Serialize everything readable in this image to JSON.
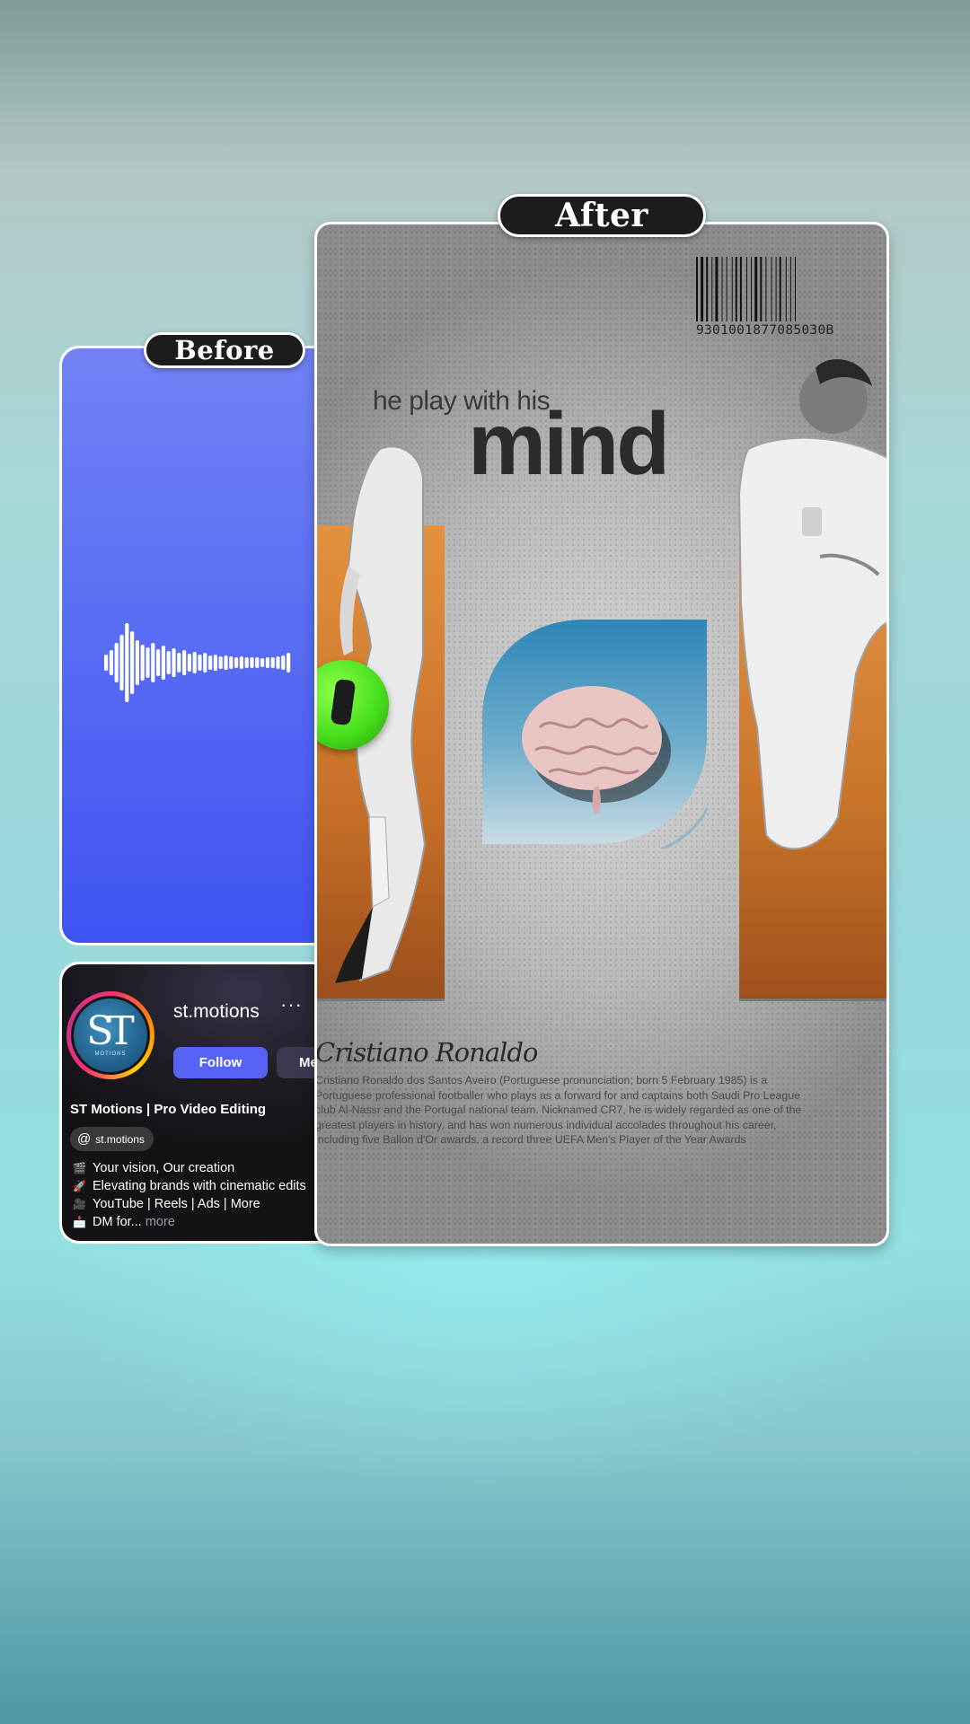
{
  "labels": {
    "before": "Before",
    "after": "After"
  },
  "profile": {
    "username": "st.motions",
    "more_dots": "···",
    "avatar_logo": "ST",
    "avatar_sub": "MOTIONS",
    "follow_label": "Follow",
    "message_label": "Me",
    "bio_name": "ST Motions | Pro Video Editing",
    "threads_handle": "st.motions",
    "bio_lines": [
      {
        "emoji": "🎬",
        "text": "Your vision, Our creation"
      },
      {
        "emoji": "🚀",
        "text": "Elevating brands with cinematic edits"
      },
      {
        "emoji": "🎥",
        "text": "YouTube | Reels | Ads | More"
      },
      {
        "emoji": "📩",
        "text": "DM for...",
        "more": "more"
      }
    ]
  },
  "poster": {
    "barcode_number": "9301001877085030B",
    "tagline": "he play with his",
    "headline": "mind",
    "name_script": "Cristiano Ronaldo",
    "bio_text": "Cristiano Ronaldo dos Santos Aveiro (Portuguese pronunciation; born 5 February 1985) is a Portuguese professional footballer who plays as a forward for and captains both Saudi Pro League club Al-Nassr and the Portugal national team. Nicknamed CR7, he is widely regarded as one of the greatest players in history, and has won numerous individual accolades throughout his career, including five Ballon d'Or awards, a record three UEFA Men's Player of the Year Awards"
  },
  "colors": {
    "before_bg": "#5a6ef4",
    "follow_button": "#5763f5",
    "orange_panel": "#d07a2f",
    "brain_tile": "#3f8fbe"
  }
}
